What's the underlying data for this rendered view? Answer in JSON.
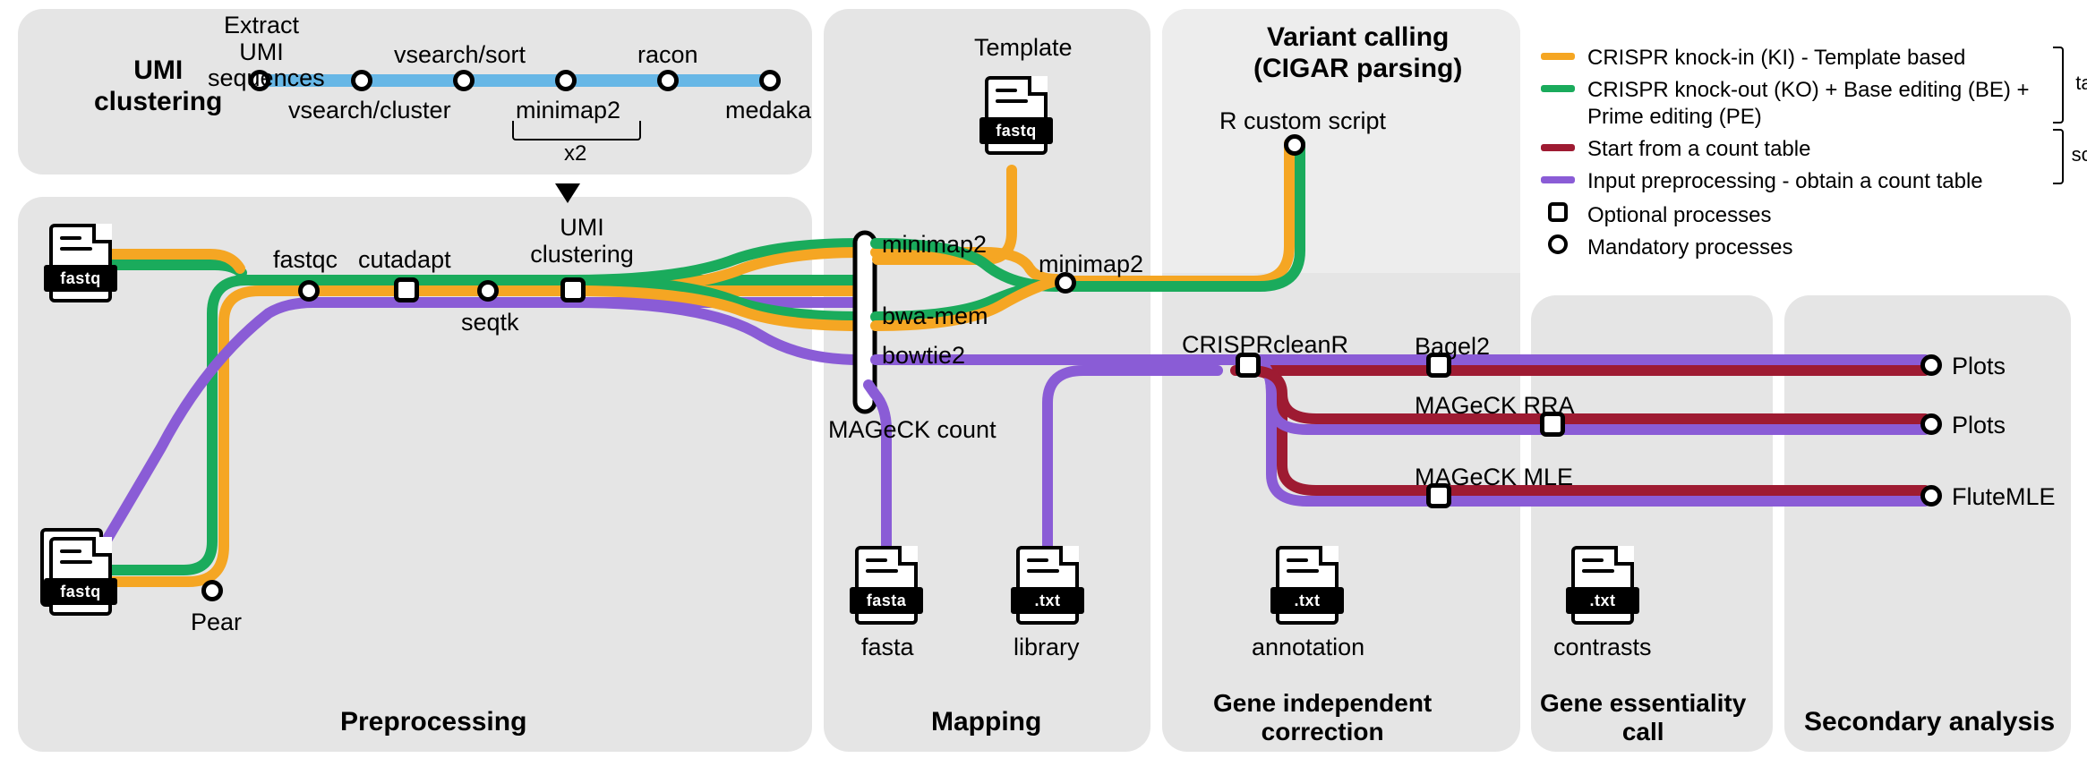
{
  "sections": {
    "umi_clustering": "UMI\nclustering",
    "preprocessing": "Preprocessing",
    "mapping": "Mapping",
    "variant_calling": "Variant calling\n(CIGAR parsing)",
    "gene_independent": "Gene independent\ncorrection",
    "gene_essentiality": "Gene essentiality\ncall",
    "secondary_analysis": "Secondary analysis"
  },
  "umi_steps": {
    "extract": "Extract UMI\nsequences",
    "vsearch_cluster": "vsearch/cluster",
    "vsearch_sort": "vsearch/sort",
    "minimap2": "minimap2",
    "racon": "racon",
    "medaka": "medaka",
    "x2": "x2"
  },
  "preprocessing": {
    "pear": "Pear",
    "fastqc": "fastqc",
    "cutadapt": "cutadapt",
    "seqtk": "seqtk",
    "umi_clustering": "UMI\nclustering"
  },
  "mapping": {
    "template": "Template",
    "minimap2_top": "minimap2",
    "bwa_mem": "bwa-mem",
    "bowtie2": "bowtie2",
    "mageck_count": "MAGeCK count",
    "minimap2_right": "minimap2"
  },
  "variant_calling": {
    "r_script": "R custom script"
  },
  "gene_indep": {
    "crisprcleanr": "CRISPRcleanR"
  },
  "gene_ess": {
    "bagel2": "Bagel2",
    "mageck_rra": "MAGeCK RRA",
    "mageck_mle": "MAGeCK MLE"
  },
  "secondary": {
    "plots": "Plots",
    "flutemle": "FluteMLE"
  },
  "files": {
    "fastq": "fastq",
    "fasta": "fasta",
    "txt": ".txt",
    "fasta_lbl": "fasta",
    "library_lbl": "library",
    "annotation_lbl": "annotation",
    "contrasts_lbl": "contrasts"
  },
  "legend": {
    "ki": "CRISPR knock-in (KI) - Template based",
    "ko": "CRISPR knock-out (KO) + Base editing (BE) + Prime editing (PE)",
    "start_count": "Start from a count table",
    "input_prep": "Input preprocessing - obtain a count table",
    "optional": "Optional processes",
    "mandatory": "Mandatory processes",
    "targeted": "targeted",
    "screening": "screening"
  },
  "colors": {
    "orange": "#f5a623",
    "green": "#1aab5c",
    "red": "#9e1b32",
    "purple": "#8a5cd6",
    "blue": "#67b7e6"
  }
}
